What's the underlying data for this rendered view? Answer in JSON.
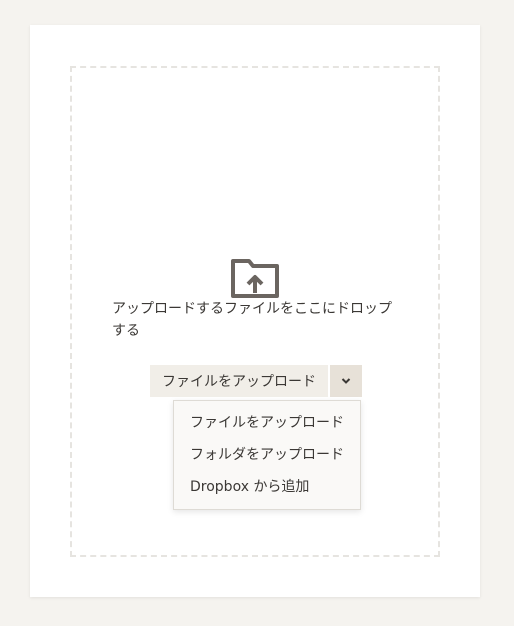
{
  "dropzone": {
    "icon": "folder-upload-icon",
    "text": "アップロードするファイルをここにドロップする"
  },
  "upload_button": {
    "label": "ファイルをアップロード",
    "toggle_icon": "chevron-down-icon"
  },
  "menu": {
    "items": [
      {
        "label": "ファイルをアップロード"
      },
      {
        "label": "フォルダをアップロード"
      },
      {
        "label": "Dropbox から追加"
      }
    ]
  },
  "colors": {
    "background": "#f5f3ef",
    "card": "#ffffff",
    "dashed_border": "#e6e4e0",
    "button_main": "#f1eee8",
    "button_toggle": "#e7e1d8",
    "icon": "#6b6560",
    "text": "#3b3835"
  }
}
